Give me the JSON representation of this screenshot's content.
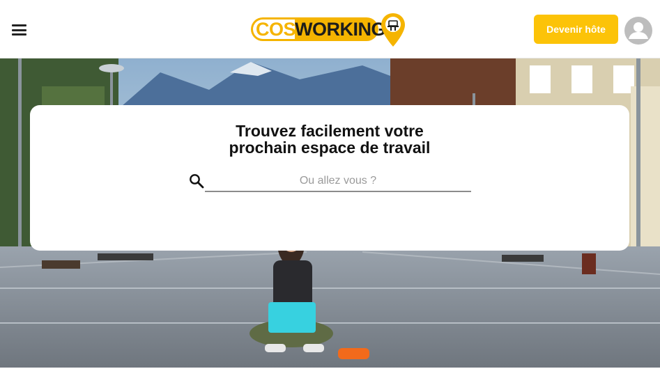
{
  "header": {
    "logo": {
      "word1": "COSY",
      "word2": "WORKING",
      "brand_color": "#f5b400"
    },
    "menu_icon": "hamburger-menu-icon",
    "host_button_label": "Devenir hôte",
    "host_button_color": "#fcc308",
    "avatar_icon": "user-avatar-icon"
  },
  "search": {
    "title_line1": "Trouvez facilement votre",
    "title_line2": "prochain espace de travail",
    "placeholder": "Ou allez vous ?",
    "value": "",
    "icon": "search-icon"
  },
  "hero": {
    "image": "hero-photo-woman-laptop-street"
  }
}
